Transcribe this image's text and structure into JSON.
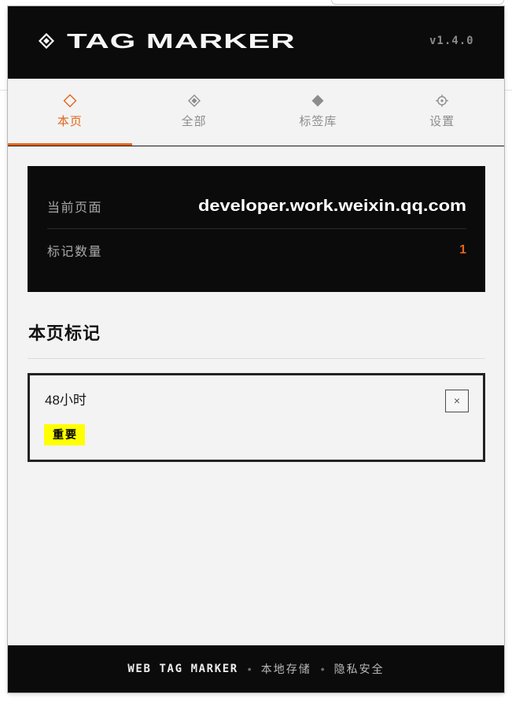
{
  "header": {
    "title": "TAG MARKER",
    "version": "v1.4.0",
    "logo_icon": "diamond-logo-icon"
  },
  "tabs": [
    {
      "label": "本页",
      "icon": "diamond-outline-icon",
      "active": true
    },
    {
      "label": "全部",
      "icon": "diamond-nested-icon",
      "active": false
    },
    {
      "label": "标签库",
      "icon": "diamond-filled-icon",
      "active": false
    },
    {
      "label": "设置",
      "icon": "settings-icon",
      "active": false
    }
  ],
  "info": {
    "current_page_label": "当前页面",
    "current_page_value": "developer.work.weixin.qq.com",
    "mark_count_label": "标记数量",
    "mark_count_value": "1"
  },
  "section": {
    "title": "本页标记"
  },
  "marks": [
    {
      "text": "48小时",
      "tag": "重要",
      "close_label": "×"
    }
  ],
  "footer": {
    "brand": "WEB TAG MARKER",
    "separator": "•",
    "item1": "本地存储",
    "item2": "隐私安全"
  },
  "colors": {
    "accent": "#e2651c",
    "dark": "#0b0b0b",
    "tag_yellow": "#ffff00"
  }
}
